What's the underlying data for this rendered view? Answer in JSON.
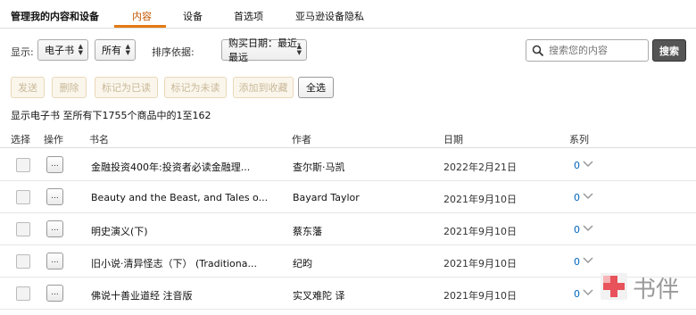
{
  "topnav": {
    "title": "管理我的内容和设备",
    "tabs": [
      {
        "label": "内容",
        "active": true
      },
      {
        "label": "设备",
        "active": false
      },
      {
        "label": "首选项",
        "active": false
      },
      {
        "label": "亚马逊设备隐私",
        "active": false
      }
    ]
  },
  "filters": {
    "show_label": "显示:",
    "type_value": "电子书",
    "scope_value": "所有",
    "sort_label": "排序依据:",
    "sort_value": "购买日期：最近-最远",
    "search_placeholder": "搜索您的内容",
    "search_button": "搜索"
  },
  "actions": {
    "send": "发送",
    "delete": "删除",
    "mark_read": "标记为已读",
    "mark_unread": "标记为未读",
    "add_collection": "添加到收藏",
    "select_all": "全选"
  },
  "summary": "显示电子书 至所有下1755个商品中的1至162",
  "table": {
    "headers": {
      "select": "选择",
      "action": "操作",
      "title": "书名",
      "author": "作者",
      "date": "日期",
      "series": "系列"
    },
    "more_label": "...",
    "rows": [
      {
        "title": "金融投资400年:投资者必读金融理...",
        "author": "查尔斯·马凯",
        "date": "2022年2月21日",
        "series": "0"
      },
      {
        "title": "Beauty and the Beast, and Tales o...",
        "author": "Bayard Taylor",
        "date": "2021年9月10日",
        "series": "0"
      },
      {
        "title": "明史演义(下)",
        "author": "蔡东藩",
        "date": "2021年9月10日",
        "series": "0"
      },
      {
        "title": "旧小说·清异怪志（下） (Traditiona...",
        "author": "纪昀",
        "date": "2021年9月10日",
        "series": "0"
      },
      {
        "title": "佛说十善业道经 注音版",
        "author": "实叉难陀 译",
        "date": "2021年9月10日",
        "series": "0"
      }
    ]
  },
  "watermark": {
    "text": "书伴",
    "accent_color": "#e8525a"
  },
  "colors": {
    "active_tab": "#c45500",
    "tab_underline": "#e47911",
    "series_link": "#0066c0",
    "search_button_bg": "#555555"
  }
}
